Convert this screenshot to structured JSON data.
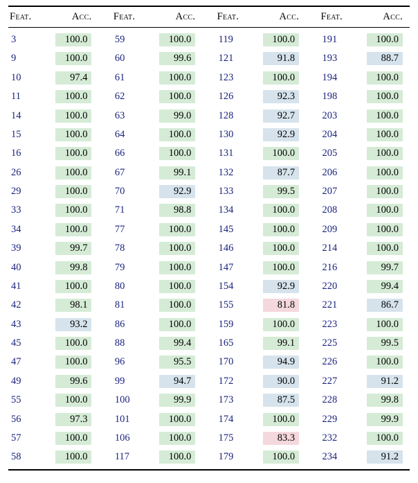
{
  "headers": {
    "feat": "Feat.",
    "acc": "Acc."
  },
  "columns": [
    [
      {
        "feat": "3",
        "acc": "100.0",
        "c": "c-green"
      },
      {
        "feat": "9",
        "acc": "100.0",
        "c": "c-green"
      },
      {
        "feat": "10",
        "acc": "97.4",
        "c": "c-green"
      },
      {
        "feat": "11",
        "acc": "100.0",
        "c": "c-green"
      },
      {
        "feat": "14",
        "acc": "100.0",
        "c": "c-green"
      },
      {
        "feat": "15",
        "acc": "100.0",
        "c": "c-green"
      },
      {
        "feat": "16",
        "acc": "100.0",
        "c": "c-green"
      },
      {
        "feat": "26",
        "acc": "100.0",
        "c": "c-green"
      },
      {
        "feat": "29",
        "acc": "100.0",
        "c": "c-green"
      },
      {
        "feat": "33",
        "acc": "100.0",
        "c": "c-green"
      },
      {
        "feat": "34",
        "acc": "100.0",
        "c": "c-green"
      },
      {
        "feat": "39",
        "acc": "99.7",
        "c": "c-green"
      },
      {
        "feat": "40",
        "acc": "99.8",
        "c": "c-green"
      },
      {
        "feat": "41",
        "acc": "100.0",
        "c": "c-green"
      },
      {
        "feat": "42",
        "acc": "98.1",
        "c": "c-green"
      },
      {
        "feat": "43",
        "acc": "93.2",
        "c": "c-blue"
      },
      {
        "feat": "45",
        "acc": "100.0",
        "c": "c-green"
      },
      {
        "feat": "47",
        "acc": "100.0",
        "c": "c-green"
      },
      {
        "feat": "49",
        "acc": "99.6",
        "c": "c-green"
      },
      {
        "feat": "55",
        "acc": "100.0",
        "c": "c-green"
      },
      {
        "feat": "56",
        "acc": "97.3",
        "c": "c-green"
      },
      {
        "feat": "57",
        "acc": "100.0",
        "c": "c-green"
      },
      {
        "feat": "58",
        "acc": "100.0",
        "c": "c-green"
      }
    ],
    [
      {
        "feat": "59",
        "acc": "100.0",
        "c": "c-green"
      },
      {
        "feat": "60",
        "acc": "99.6",
        "c": "c-green"
      },
      {
        "feat": "61",
        "acc": "100.0",
        "c": "c-green"
      },
      {
        "feat": "62",
        "acc": "100.0",
        "c": "c-green"
      },
      {
        "feat": "63",
        "acc": "99.0",
        "c": "c-green"
      },
      {
        "feat": "64",
        "acc": "100.0",
        "c": "c-green"
      },
      {
        "feat": "66",
        "acc": "100.0",
        "c": "c-green"
      },
      {
        "feat": "67",
        "acc": "99.1",
        "c": "c-green"
      },
      {
        "feat": "70",
        "acc": "92.9",
        "c": "c-blue"
      },
      {
        "feat": "71",
        "acc": "98.8",
        "c": "c-green"
      },
      {
        "feat": "77",
        "acc": "100.0",
        "c": "c-green"
      },
      {
        "feat": "78",
        "acc": "100.0",
        "c": "c-green"
      },
      {
        "feat": "79",
        "acc": "100.0",
        "c": "c-green"
      },
      {
        "feat": "80",
        "acc": "100.0",
        "c": "c-green"
      },
      {
        "feat": "81",
        "acc": "100.0",
        "c": "c-green"
      },
      {
        "feat": "86",
        "acc": "100.0",
        "c": "c-green"
      },
      {
        "feat": "88",
        "acc": "99.4",
        "c": "c-green"
      },
      {
        "feat": "96",
        "acc": "95.5",
        "c": "c-green"
      },
      {
        "feat": "99",
        "acc": "94.7",
        "c": "c-blue"
      },
      {
        "feat": "100",
        "acc": "99.9",
        "c": "c-green"
      },
      {
        "feat": "101",
        "acc": "100.0",
        "c": "c-green"
      },
      {
        "feat": "106",
        "acc": "100.0",
        "c": "c-green"
      },
      {
        "feat": "117",
        "acc": "100.0",
        "c": "c-green"
      }
    ],
    [
      {
        "feat": "119",
        "acc": "100.0",
        "c": "c-green"
      },
      {
        "feat": "121",
        "acc": "91.8",
        "c": "c-blue"
      },
      {
        "feat": "123",
        "acc": "100.0",
        "c": "c-green"
      },
      {
        "feat": "126",
        "acc": "92.3",
        "c": "c-blue"
      },
      {
        "feat": "128",
        "acc": "92.7",
        "c": "c-blue"
      },
      {
        "feat": "130",
        "acc": "92.9",
        "c": "c-blue"
      },
      {
        "feat": "131",
        "acc": "100.0",
        "c": "c-green"
      },
      {
        "feat": "132",
        "acc": "87.7",
        "c": "c-blue"
      },
      {
        "feat": "133",
        "acc": "99.5",
        "c": "c-green"
      },
      {
        "feat": "134",
        "acc": "100.0",
        "c": "c-green"
      },
      {
        "feat": "145",
        "acc": "100.0",
        "c": "c-green"
      },
      {
        "feat": "146",
        "acc": "100.0",
        "c": "c-green"
      },
      {
        "feat": "147",
        "acc": "100.0",
        "c": "c-green"
      },
      {
        "feat": "154",
        "acc": "92.9",
        "c": "c-blue"
      },
      {
        "feat": "155",
        "acc": "81.8",
        "c": "c-pink"
      },
      {
        "feat": "159",
        "acc": "100.0",
        "c": "c-green"
      },
      {
        "feat": "165",
        "acc": "99.1",
        "c": "c-green"
      },
      {
        "feat": "170",
        "acc": "94.9",
        "c": "c-blue"
      },
      {
        "feat": "172",
        "acc": "90.0",
        "c": "c-blue"
      },
      {
        "feat": "173",
        "acc": "87.5",
        "c": "c-blue"
      },
      {
        "feat": "174",
        "acc": "100.0",
        "c": "c-green"
      },
      {
        "feat": "175",
        "acc": "83.3",
        "c": "c-pink"
      },
      {
        "feat": "179",
        "acc": "100.0",
        "c": "c-green"
      }
    ],
    [
      {
        "feat": "191",
        "acc": "100.0",
        "c": "c-green"
      },
      {
        "feat": "193",
        "acc": "88.7",
        "c": "c-blue"
      },
      {
        "feat": "194",
        "acc": "100.0",
        "c": "c-green"
      },
      {
        "feat": "198",
        "acc": "100.0",
        "c": "c-green"
      },
      {
        "feat": "203",
        "acc": "100.0",
        "c": "c-green"
      },
      {
        "feat": "204",
        "acc": "100.0",
        "c": "c-green"
      },
      {
        "feat": "205",
        "acc": "100.0",
        "c": "c-green"
      },
      {
        "feat": "206",
        "acc": "100.0",
        "c": "c-green"
      },
      {
        "feat": "207",
        "acc": "100.0",
        "c": "c-green"
      },
      {
        "feat": "208",
        "acc": "100.0",
        "c": "c-green"
      },
      {
        "feat": "209",
        "acc": "100.0",
        "c": "c-green"
      },
      {
        "feat": "214",
        "acc": "100.0",
        "c": "c-green"
      },
      {
        "feat": "216",
        "acc": "99.7",
        "c": "c-green"
      },
      {
        "feat": "220",
        "acc": "99.4",
        "c": "c-green"
      },
      {
        "feat": "221",
        "acc": "86.7",
        "c": "c-blue"
      },
      {
        "feat": "223",
        "acc": "100.0",
        "c": "c-green"
      },
      {
        "feat": "225",
        "acc": "99.5",
        "c": "c-green"
      },
      {
        "feat": "226",
        "acc": "100.0",
        "c": "c-green"
      },
      {
        "feat": "227",
        "acc": "91.2",
        "c": "c-blue"
      },
      {
        "feat": "228",
        "acc": "99.8",
        "c": "c-green"
      },
      {
        "feat": "229",
        "acc": "99.9",
        "c": "c-green"
      },
      {
        "feat": "232",
        "acc": "100.0",
        "c": "c-green"
      },
      {
        "feat": "234",
        "acc": "91.2",
        "c": "c-blue"
      }
    ]
  ]
}
